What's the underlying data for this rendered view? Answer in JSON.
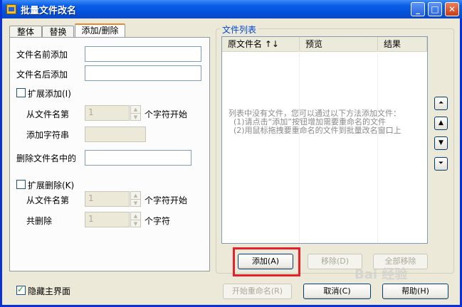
{
  "window": {
    "title": "批量文件改名"
  },
  "tabs": [
    {
      "label": "整体"
    },
    {
      "label": "替换"
    },
    {
      "label": "添加/删除"
    }
  ],
  "add_delete": {
    "prefix_label": "文件名前添加",
    "prefix_value": "",
    "suffix_label": "文件名后添加",
    "suffix_value": "",
    "extend_add_label": "扩展添加(I)",
    "from_char_label": "从文件名第",
    "from_char_value": "1",
    "char_start_label": "个字符开始",
    "add_string_label": "添加字符串",
    "add_string_value": "",
    "delete_in_name_label": "删除文件名中的",
    "delete_in_name_value": "",
    "extend_delete_label": "扩展删除(K)",
    "del_from_char_label": "从文件名第",
    "del_from_char_value": "1",
    "del_char_start_label": "个字符开始",
    "del_total_label": "共删除",
    "del_total_value": "1",
    "del_char_unit_label": "个字符"
  },
  "file_list": {
    "group_title": "文件列表",
    "columns": [
      {
        "label": "原文件名  ↑↓"
      },
      {
        "label": "预览"
      },
      {
        "label": "结果"
      }
    ],
    "empty_hint": [
      "列表中没有文件，您可以通过以下方法添加文件：",
      "(1)请点击“添加”按钮增加需要重命名的文件",
      "(2)用鼠标拖拽要重命名的文件到批量改名窗口上"
    ],
    "add_button": "添加(A)",
    "remove_button": "移除(D)",
    "remove_all_button": "全部移除"
  },
  "side_buttons": [
    {
      "glyph": "⏶"
    },
    {
      "glyph": "▲"
    },
    {
      "glyph": "▼"
    },
    {
      "glyph": "⏷"
    }
  ],
  "bottom": {
    "hide_main_label": "隐藏主界面",
    "start_rename_button": "开始重命名(R)",
    "cancel_button": "取消(C)",
    "help_button": "帮助(H)"
  },
  "watermark": "Bai 经验",
  "colors": {
    "titlebar": "#0a5ee8",
    "accent": "#0046d5",
    "highlight": "#e8202a"
  }
}
